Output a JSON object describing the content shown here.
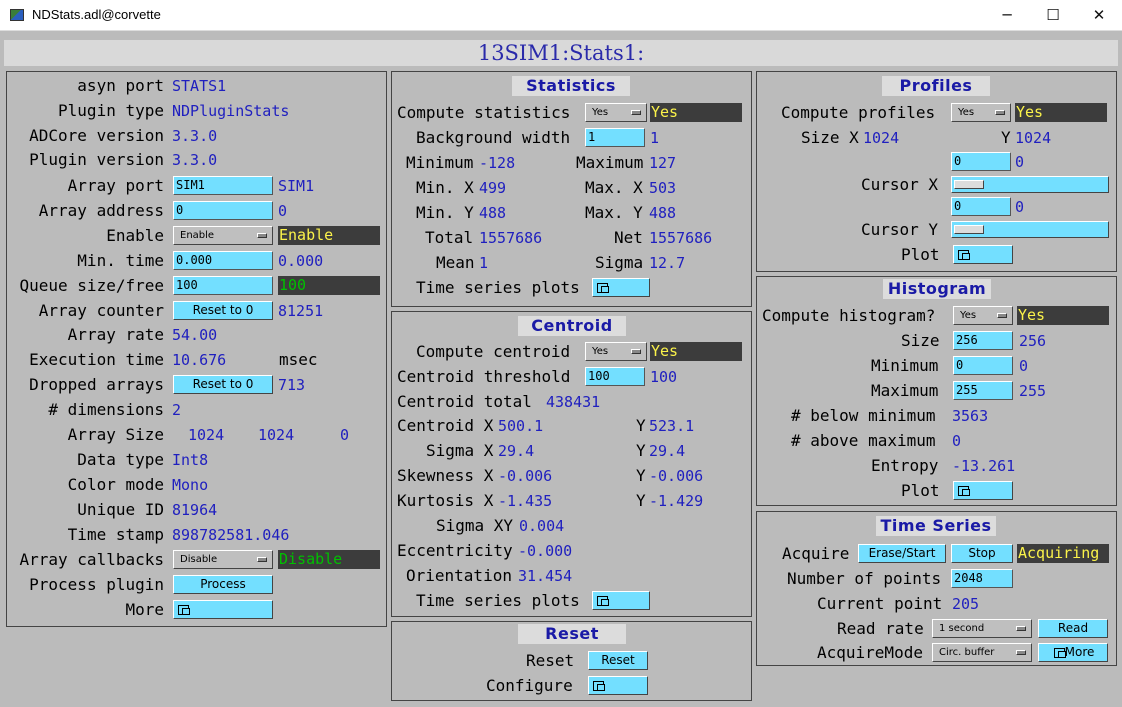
{
  "window": {
    "title": "NDStats.adl@corvette",
    "minimize": "─",
    "maximize": "☐",
    "close": "✕"
  },
  "main_title": "13SIM1:Stats1:",
  "left": {
    "asyn_port_label": "asyn port",
    "asyn_port": "STATS1",
    "plugin_type_label": "Plugin type",
    "plugin_type": "NDPluginStats",
    "adcore_version_label": "ADCore version",
    "adcore_version": "3.3.0",
    "plugin_version_label": "Plugin version",
    "plugin_version": "3.3.0",
    "array_port_label": "Array port",
    "array_port_input": "SIM1",
    "array_port": "SIM1",
    "array_address_label": "Array address",
    "array_address_input": "0",
    "array_address": "0",
    "enable_label": "Enable",
    "enable_menu": "Enable",
    "enable_status": "Enable",
    "min_time_label": "Min. time",
    "min_time_input": "0.000",
    "min_time": "0.000",
    "queue_label": "Queue size/free",
    "queue_input": "100",
    "queue_free": "100",
    "array_counter_label": "Array counter",
    "array_counter_button": "Reset to 0",
    "array_counter": "81251",
    "array_rate_label": "Array rate",
    "array_rate": "54.00",
    "exec_time_label": "Execution time",
    "exec_time": "10.676",
    "exec_unit": "msec",
    "dropped_label": "Dropped arrays",
    "dropped_button": "Reset to 0",
    "dropped": "713",
    "dims_label": "# dimensions",
    "dims": "2",
    "array_size_label": "Array Size",
    "array_size": [
      "1024",
      "1024",
      "0"
    ],
    "data_type_label": "Data type",
    "data_type": "Int8",
    "color_mode_label": "Color mode",
    "color_mode": "Mono",
    "unique_id_label": "Unique ID",
    "unique_id": "81964",
    "time_stamp_label": "Time stamp",
    "time_stamp": "898782581.046",
    "callbacks_label": "Array callbacks",
    "callbacks_menu": "Disable",
    "callbacks_status": "Disable",
    "process_label": "Process plugin",
    "process_button": "Process",
    "more_label": "More"
  },
  "statistics": {
    "title": "Statistics",
    "compute_label": "Compute statistics",
    "compute_menu": "Yes",
    "compute_status": "Yes",
    "bgw_label": "Background width",
    "bgw_input": "1",
    "bgw": "1",
    "min_label": "Minimum",
    "min": "-128",
    "max_label": "Maximum",
    "max": "127",
    "minx_label": "Min. X",
    "minx": "499",
    "maxx_label": "Max. X",
    "maxx": "503",
    "miny_label": "Min. Y",
    "miny": "488",
    "maxy_label": "Max. Y",
    "maxy": "488",
    "total_label": "Total",
    "total": "1557686",
    "net_label": "Net",
    "net": "1557686",
    "mean_label": "Mean",
    "mean": "1",
    "sigma_label": "Sigma",
    "sigma": "12.7",
    "ts_label": "Time series plots"
  },
  "centroid": {
    "title": "Centroid",
    "compute_label": "Compute centroid",
    "compute_menu": "Yes",
    "compute_status": "Yes",
    "threshold_label": "Centroid threshold",
    "threshold_input": "100",
    "threshold": "100",
    "total_label": "Centroid total",
    "total": "438431",
    "cx_label": "Centroid X",
    "cx": "500.1",
    "cy_label": "Y",
    "cy": "523.1",
    "sx_label": "Sigma X",
    "sx": "29.4",
    "sy_label": "Y",
    "sy": "29.4",
    "skx_label": "Skewness X",
    "skx": "-0.006",
    "sky_label": "Y",
    "sky": "-0.006",
    "kx_label": "Kurtosis X",
    "kx": "-1.435",
    "ky_label": "Y",
    "ky": "-1.429",
    "sxy_label": "Sigma XY",
    "sxy": "0.004",
    "ecc_label": "Eccentricity",
    "ecc": "-0.000",
    "orient_label": "Orientation",
    "orient": "31.454",
    "ts_label": "Time series plots"
  },
  "reset": {
    "title": "Reset",
    "reset_label": "Reset",
    "reset_button": "Reset",
    "configure_label": "Configure"
  },
  "profiles": {
    "title": "Profiles",
    "compute_label": "Compute profiles",
    "compute_menu": "Yes",
    "compute_status": "Yes",
    "sizex_label": "Size X",
    "sizex": "1024",
    "sizey_label": "Y",
    "sizey": "1024",
    "cursorx_input": "0",
    "cursorx": "0",
    "cursorx_label": "Cursor X",
    "cursory_input": "0",
    "cursory": "0",
    "cursory_label": "Cursor Y",
    "cursorx_level": 0.0,
    "cursory_level": 0.0,
    "plot_label": "Plot"
  },
  "histogram": {
    "title": "Histogram",
    "compute_label": "Compute histogram?",
    "compute_menu": "Yes",
    "compute_status": "Yes",
    "size_label": "Size",
    "size_input": "256",
    "size": "256",
    "min_label": "Minimum",
    "min_input": "0",
    "min": "0",
    "max_label": "Maximum",
    "max_input": "255",
    "max": "255",
    "below_label": "# below minimum",
    "below": "3563",
    "above_label": "# above maximum",
    "above": "0",
    "entropy_label": "Entropy",
    "entropy": "-13.261",
    "plot_label": "Plot"
  },
  "time_series": {
    "title": "Time Series",
    "acquire_label": "Acquire",
    "erase_start": "Erase/Start",
    "stop": "Stop",
    "acquire_status": "Acquiring",
    "npoints_label": "Number of points",
    "npoints_input": "2048",
    "current_label": "Current point",
    "current": "205",
    "read_rate_label": "Read rate",
    "read_rate_menu": "1 second",
    "read_button": "Read",
    "mode_label": "AcquireMode",
    "mode_menu": "Circ. buffer",
    "more_button": "More"
  },
  "colors": {
    "background": "#bbbbbb",
    "input": "#73dfff",
    "value_text": "#1f1fbf",
    "status_bg": "#3c3c3c",
    "status_yes": "#fbf34a",
    "status_green": "#00c000",
    "title_text": "#1a1aa6"
  }
}
